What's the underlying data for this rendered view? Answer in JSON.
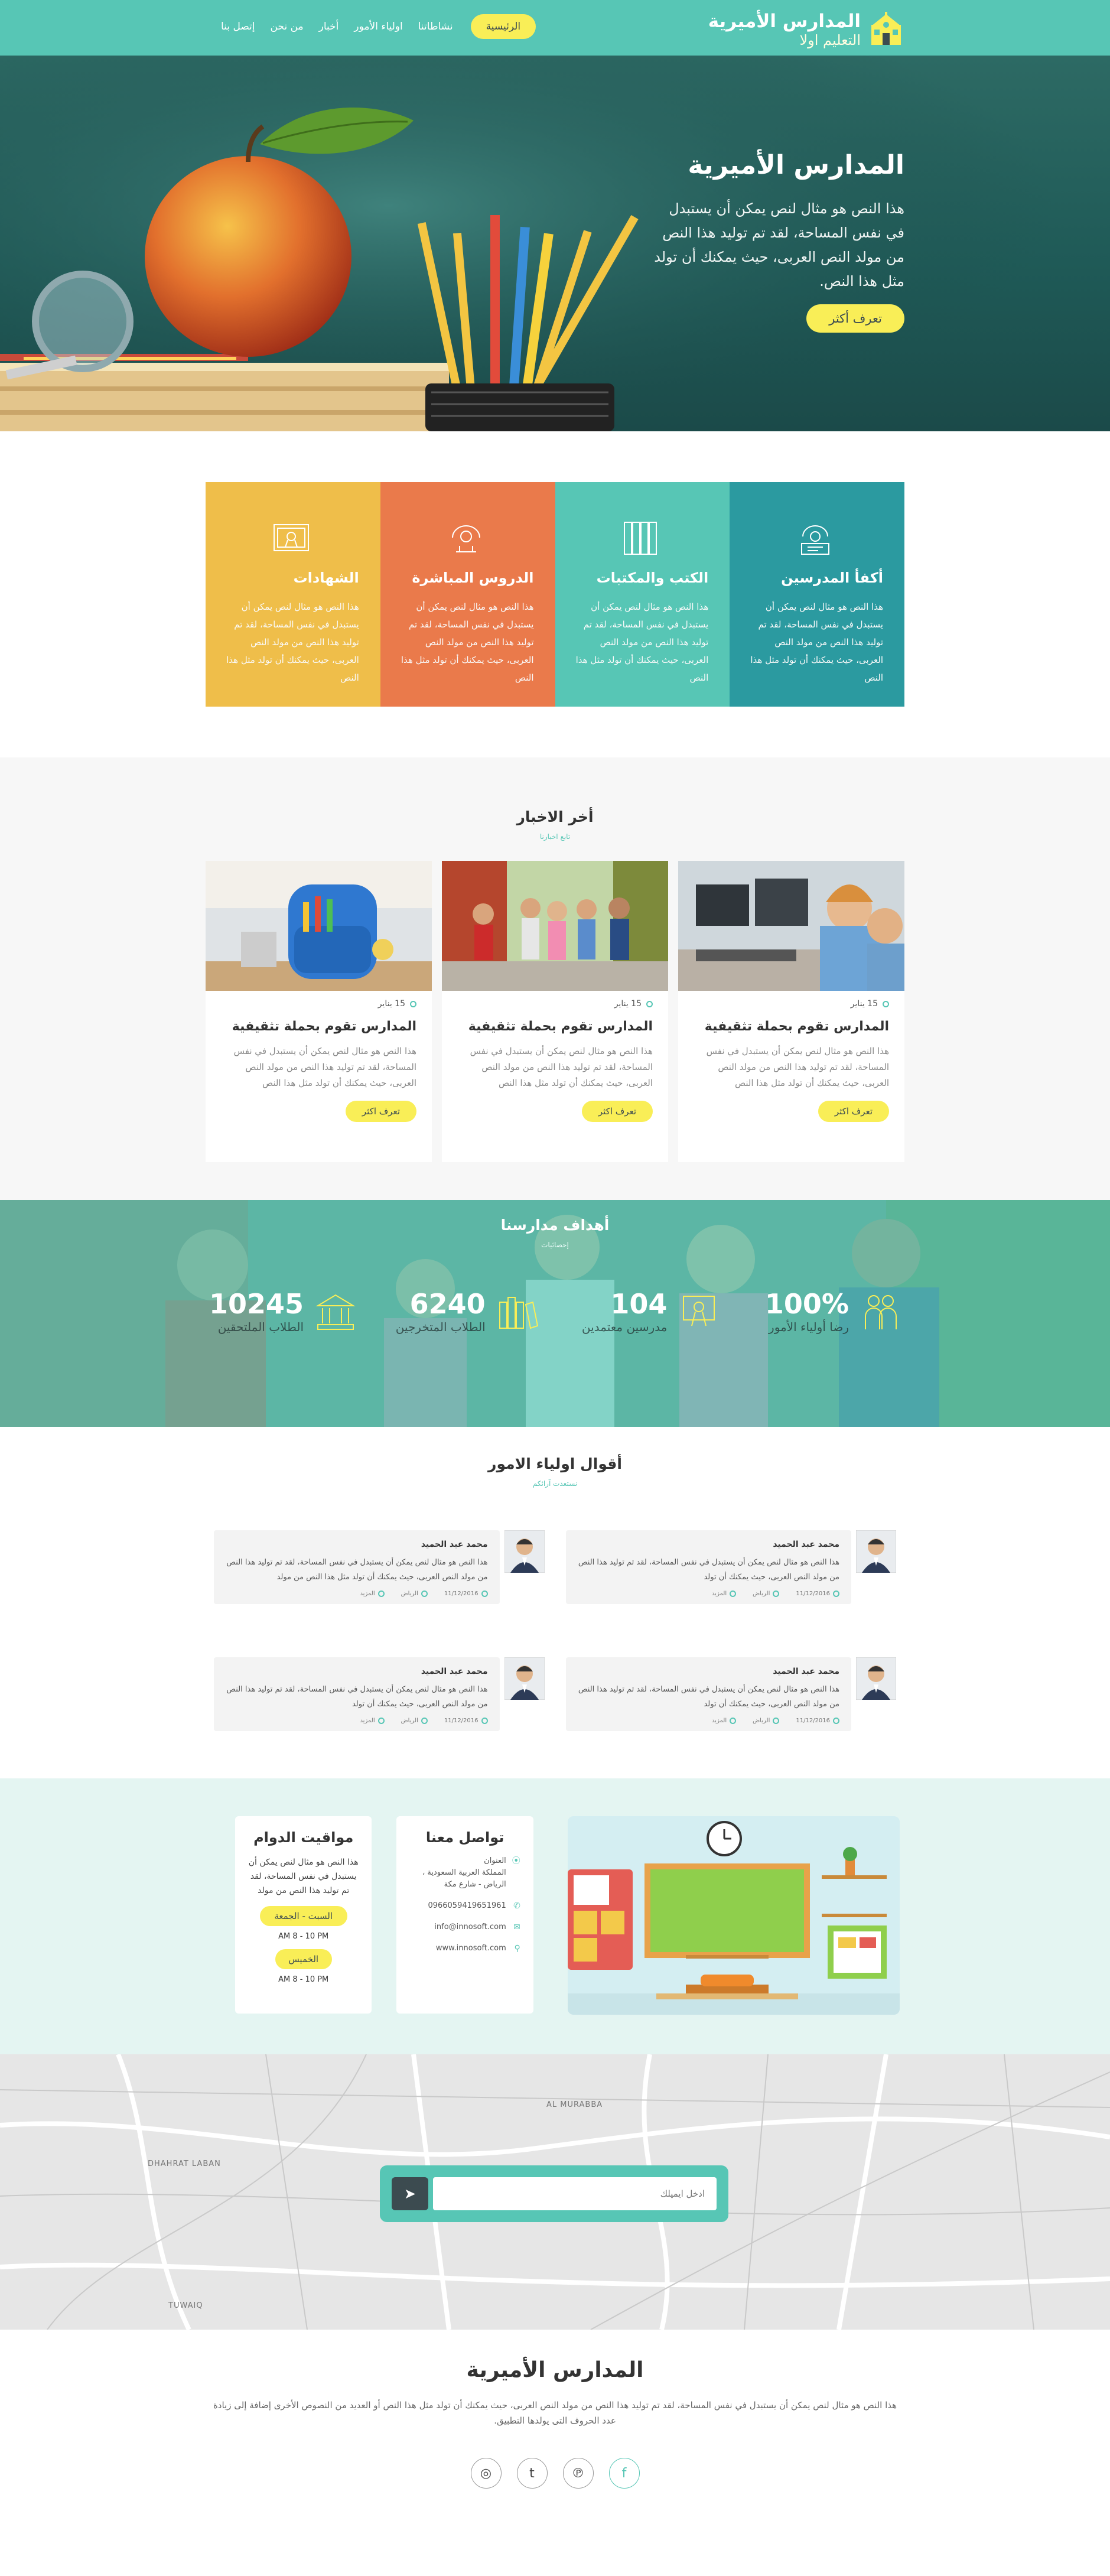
{
  "header": {
    "logo_title": "المدارس الأميرية",
    "logo_tagline": "التعليم اولا",
    "nav": [
      "الرئيسية",
      "نشاطاتنا",
      "اولياء الأمور",
      "أخبار",
      "من نحن",
      "إتصل بنا"
    ]
  },
  "hero": {
    "title": "المدارس الأميرية",
    "text": "هذا النص هو مثال لنص يمكن أن يستبدل في نفس المساحة، لقد تم توليد هذا النص من مولد النص العربى، حيث يمكنك أن تولد مثل هذا النص.",
    "button": "تعرف أكثر"
  },
  "features": [
    {
      "title": "أكفأ المدرسين",
      "text": "هذا النص هو مثال لنص يمكن أن يستبدل في نفس المساحة، لقد تم توليد هذا النص من مولد النص العربى، حيث يمكنك أن تولد مثل هذا النص",
      "color": "#2b9aa0",
      "icon": "teacher-icon"
    },
    {
      "title": "الكتب والمكتبات",
      "text": "هذا النص هو مثال لنص يمكن أن يستبدل في نفس المساحة، لقد تم توليد هذا النص من مولد النص العربى، حيث يمكنك أن تولد مثل هذا النص",
      "color": "#57c6b5",
      "icon": "books-icon"
    },
    {
      "title": "الدروس المباشرة",
      "text": "هذا النص هو مثال لنص يمكن أن يستبدل في نفس المساحة، لقد تم توليد هذا النص من مولد النص العربى، حيث يمكنك أن تولد مثل هذا النص",
      "color": "#ea7a4b",
      "icon": "live-lesson-icon"
    },
    {
      "title": "الشهادات",
      "text": "هذا النص هو مثال لنص يمكن أن يستبدل في نفس المساحة، لقد تم توليد هذا النص من مولد النص العربى، حيث يمكنك أن تولد مثل هذا النص",
      "color": "#efbe4a",
      "icon": "certificate-icon"
    }
  ],
  "news": {
    "title": "أخر الاخبار",
    "subtitle": "تابع اخبارنا",
    "items": [
      {
        "date": "15 يناير",
        "title": "المدارس تقوم بحملة تثقيفية",
        "text": "هذا النص هو مثال لنص يمكن أن يستبدل في نفس المساحة، لقد تم توليد هذا النص من مولد النص العربى، حيث يمكنك أن تولد مثل هذا النص",
        "button": "تعرف اكثر"
      },
      {
        "date": "15 يناير",
        "title": "المدارس تقوم بحملة تثقيفية",
        "text": "هذا النص هو مثال لنص يمكن أن يستبدل في نفس المساحة، لقد تم توليد هذا النص من مولد النص العربى، حيث يمكنك أن تولد مثل هذا النص",
        "button": "تعرف اكثر"
      },
      {
        "date": "15 يناير",
        "title": "المدارس تقوم بحملة تثقيفية",
        "text": "هذا النص هو مثال لنص يمكن أن يستبدل في نفس المساحة، لقد تم توليد هذا النص من مولد النص العربى، حيث يمكنك أن تولد مثل هذا النص",
        "button": "تعرف اكثر"
      }
    ]
  },
  "stats": {
    "title": "أهداف مدارسنا",
    "subtitle": "إحصائيات",
    "items": [
      {
        "num": "100%",
        "label": "رضا أولياء الأمور"
      },
      {
        "num": "104",
        "label": "مدرسين معتمدين"
      },
      {
        "num": "6240",
        "label": "الطلاب المتخرجين"
      },
      {
        "num": "10245",
        "label": "الطلاب الملتحقين"
      }
    ]
  },
  "testimonials": {
    "title": "أقوال اولياء الامور",
    "subtitle": "نستعدت آرائكم",
    "items": [
      {
        "name": "محمد عبد الحميد",
        "text": "هذا النص هو مثال لنص يمكن أن يستبدل في نفس المساحة، لقد تم توليد هذا النص من مولد النص العربى، حيث يمكنك أن تولد",
        "date": "11/12/2016",
        "city": "الرياض",
        "tag": "المزيد"
      },
      {
        "name": "محمد عبد الحميد",
        "text": "هذا النص هو مثال لنص يمكن أن يستبدل في نفس المساحة، لقد تم توليد هذا النص من مولد النص العربى، حيث يمكنك أن تولد مثل هذا النص من مولد",
        "date": "11/12/2016",
        "city": "الرياض",
        "tag": "المزيد"
      },
      {
        "name": "محمد عبد الحميد",
        "text": "هذا النص هو مثال لنص يمكن أن يستبدل في نفس المساحة، لقد تم توليد هذا النص من مولد النص العربى، حيث يمكنك أن تولد",
        "date": "11/12/2016",
        "city": "الرياض",
        "tag": "المزيد"
      },
      {
        "name": "محمد عبد الحميد",
        "text": "هذا النص هو مثال لنص يمكن أن يستبدل في نفس المساحة، لقد تم توليد هذا النص من مولد النص العربى، حيث يمكنك أن تولد",
        "date": "11/12/2016",
        "city": "الرياض",
        "tag": "المزيد"
      }
    ]
  },
  "contact": {
    "title": "تواصل معنا",
    "address_label": "العنوان",
    "address": "المملكة العربية السعودية ، الرياض - شارع مكة",
    "phone": "0966059419651961",
    "email": "info@innosoft.com",
    "web": "www.innosoft.com"
  },
  "hours": {
    "title": "مواقيت الدوام",
    "text": "هذا النص هو مثال لنص يمكن أن يستبدل في نفس المساحة، لقد تم توليد هذا النص من مولد",
    "day1": "السبت - الجمعة",
    "time1": "AM 8 - 10 PM",
    "day2": "الخميس",
    "time2": "AM 8 - 10 PM"
  },
  "map": {
    "placeholder": "ادخل ايميلك",
    "labels": [
      "AL MURABBA",
      "DHAHRAT LABAN",
      "TUWAIQ"
    ]
  },
  "footer": {
    "title": "المدارس الأميرية",
    "text": "هذا النص هو مثال لنص يمكن أن يستبدل في نفس المساحة، لقد تم توليد هذا النص من مولد النص العربى، حيث يمكنك أن تولد مثل هذا النص أو العديد من النصوص الأخرى إضافة إلى زيادة عدد الحروف التى يولدها التطبيق.",
    "social": [
      "instagram-icon",
      "twitter-icon",
      "pinterest-icon",
      "facebook-icon"
    ]
  },
  "colors": {
    "primary": "#57c6b5",
    "accent": "#f9ee57",
    "dark": "#3c4b50"
  }
}
